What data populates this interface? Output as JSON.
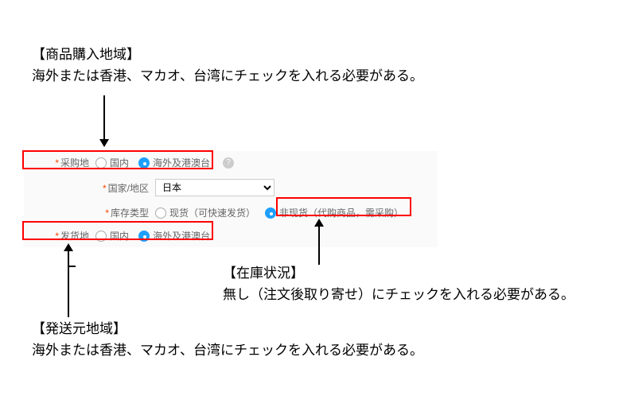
{
  "annotations": {
    "purchase_region": {
      "title": "【商品購入地域】",
      "text": "海外または香港、マカオ、台湾にチェックを入れる必要がある。"
    },
    "stock_status": {
      "title": "【在庫状況】",
      "text": "無し（注文後取り寄せ）にチェックを入れる必要がある。"
    },
    "ship_region": {
      "title": "【発送元地域】",
      "text": "海外または香港、マカオ、台湾にチェックを入れる必要がある。"
    }
  },
  "form": {
    "purchase_region": {
      "label": "采购地",
      "options": {
        "domestic": "国内",
        "overseas": "海外及港澳台"
      },
      "selected": "overseas"
    },
    "country": {
      "label": "国家/地区",
      "selected": "日本"
    },
    "stock_type": {
      "label": "库存类型",
      "options": {
        "in_stock": "现货（可快速发货）",
        "not_in_stock": "非现货（代购商品，需采购）"
      },
      "selected": "not_in_stock"
    },
    "ship_region": {
      "label": "发货地",
      "options": {
        "domestic": "国内",
        "overseas": "海外及港澳台"
      },
      "selected": "overseas"
    }
  }
}
